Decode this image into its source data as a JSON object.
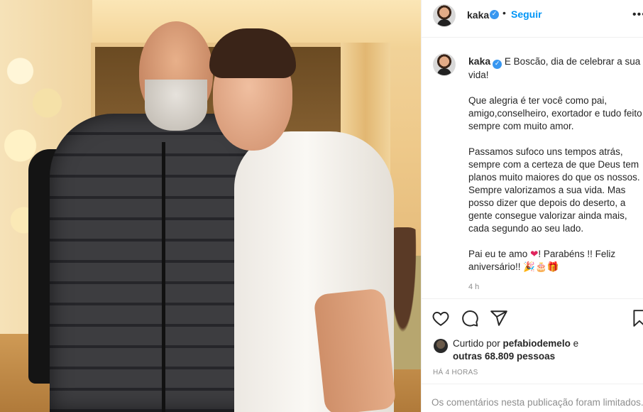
{
  "post": {
    "username": "kaka",
    "follow_label": "Seguir",
    "dot": "•",
    "more_label": "•••",
    "caption_lead": "E Boscão, dia de celebrar a sua vida!",
    "caption_p2": "Que alegria é ter você como pai, amigo,conselheiro, exortador e tudo feito sempre com muito amor.",
    "caption_p3": "Passamos sufoco uns tempos atrás, sempre com a certeza de que Deus tem planos muito maiores do que os nossos. Sempre valorizamos a sua vida. Mas posso dizer que depois do deserto, a gente consegue valorizar ainda mais, cada segundo ao seu lado.",
    "caption_p4_a": "Pai eu te amo ",
    "caption_p4_heart": "❤",
    "caption_p4_b": "! Parabéns !! Feliz aniversário!! 🎉🎂🎁",
    "time_ago": "4 h",
    "liked_by_prefix": "Curtido por ",
    "liked_by_user": "pefabiodemelo",
    "liked_by_and": " e",
    "likes_count": "outras 68.809 pessoas",
    "date": "HÁ 4 HORAS",
    "comments_off": "Os comentários nesta publicação foram limitados."
  },
  "icons": {
    "verified": "verified-badge-icon",
    "like": "heart-outline-icon",
    "comment": "speech-bubble-icon",
    "share": "paper-plane-icon",
    "save": "bookmark-icon"
  },
  "colors": {
    "accent": "#0095f6",
    "verified": "#3897f0",
    "muted": "#8e8e8e",
    "text": "#262626",
    "heart": "#e0245e"
  }
}
